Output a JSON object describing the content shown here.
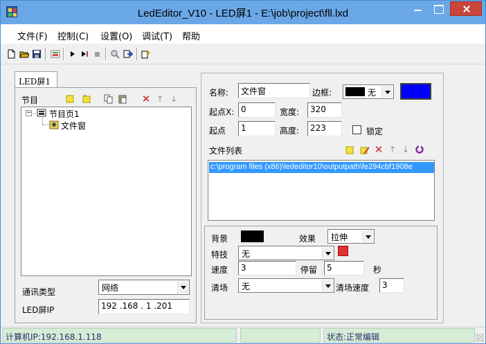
{
  "window": {
    "title": "LedEditor_V10 - LED屏1 - E:\\job\\project\\fll.lxd"
  },
  "menubar": {
    "items": [
      {
        "label": "文件(F)"
      },
      {
        "label": "控制(C)"
      },
      {
        "label": "设置(O)"
      },
      {
        "label": "调试(T)"
      },
      {
        "label": "帮助"
      }
    ]
  },
  "toolbar": {
    "icons": [
      "new-file-icon",
      "open-folder-icon",
      "save-icon",
      "program-icon",
      "play-icon",
      "step-play-icon",
      "stop-icon",
      "search-icon",
      "export-icon",
      "help-icon"
    ]
  },
  "left_panel": {
    "tab_label": "LED屏1",
    "program_label": "节目",
    "tree": {
      "page_label": "节目页1",
      "window_label": "文件窗"
    },
    "comm_type_label": "通讯类型",
    "comm_type_value": "网络",
    "led_ip_label": "LED屏IP",
    "led_ip_value": "192 .168 . 1  .201"
  },
  "right_panel": {
    "name_label": "名称:",
    "name_value": "文件窗",
    "border_label": "边框:",
    "border_value": "无",
    "start_x_label": "起点X:",
    "start_x_value": "0",
    "width_label": "宽度:",
    "width_value": "320",
    "start_y_label": "起点",
    "start_y_value": "1",
    "height_label": "高度:",
    "height_value": "223",
    "lock_label": "锁定",
    "file_list_label": "文件列表",
    "file_list_items": [
      "c:\\program files (x86)\\lededitor10\\outputpath\\fe294cbf1908e"
    ],
    "background_label": "背景",
    "effect_label": "效果",
    "effect_value": "拉伸",
    "special_label": "特技",
    "special_value": "无",
    "speed_label": "速度",
    "speed_value": "3",
    "stay_label": "停留",
    "stay_value": "5",
    "stay_unit": "秒",
    "clear_label": "清场",
    "clear_value": "无",
    "clear_speed_label": "清场速度",
    "clear_speed_value": "3"
  },
  "statusbar": {
    "computer_ip": "计算机IP:192.168.1.118",
    "status": "状态:正常编辑"
  },
  "colors": {
    "title_bar": "#6aa7e6",
    "border_swatch": "#0000ff",
    "close_button": "#c7453a",
    "selection": "#3399ff",
    "status_bg": "#d5ecd6"
  }
}
